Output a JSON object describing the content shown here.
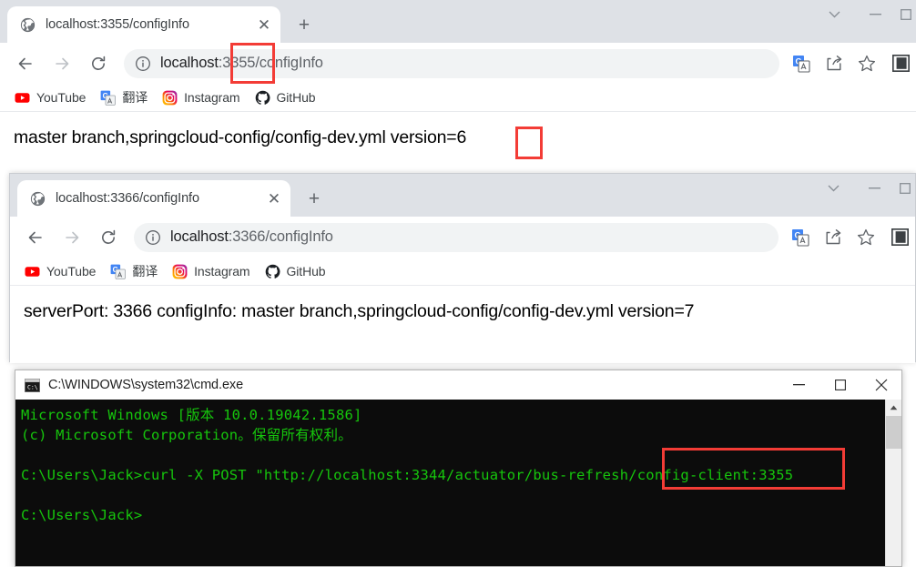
{
  "windows": {
    "browser1": {
      "tab": {
        "title": "localhost:3355/configInfo",
        "favicon": "globe-icon",
        "close_label": "✕",
        "newtab_label": "+"
      },
      "window_controls": {
        "tab_search": "chevron-down-icon",
        "minimize": "—",
        "maximize": "maximize-icon"
      },
      "toolbar": {
        "back": "back-arrow-icon",
        "forward": "forward-arrow-icon",
        "reload": "reload-icon",
        "info": "info-circle-icon",
        "url_prefix": "localhost",
        "url_port": ":3355",
        "url_path": "/configInfo",
        "url_full": "localhost:3355/configInfo",
        "translate": "translate-icon",
        "share": "share-icon",
        "bookmark": "star-icon",
        "side_panel": "side-panel-icon"
      },
      "bookmarks": [
        {
          "label": "YouTube",
          "icon": "youtube-icon"
        },
        {
          "label": "翻译",
          "icon": "google-translate-icon"
        },
        {
          "label": "Instagram",
          "icon": "instagram-icon"
        },
        {
          "label": "GitHub",
          "icon": "github-icon"
        }
      ],
      "content": {
        "text": "master branch,springcloud-config/config-dev.yml version=6",
        "highlighted_value": "6"
      }
    },
    "browser2": {
      "tab": {
        "title": "localhost:3366/configInfo",
        "favicon": "globe-icon",
        "close_label": "✕",
        "newtab_label": "+"
      },
      "window_controls": {
        "tab_search": "chevron-down-icon",
        "minimize": "—",
        "maximize": "maximize-icon"
      },
      "toolbar": {
        "back": "back-arrow-icon",
        "forward": "forward-arrow-icon",
        "reload": "reload-icon",
        "info": "info-circle-icon",
        "url_prefix": "localhost",
        "url_port": ":3366",
        "url_path": "/configInfo",
        "url_full": "localhost:3366/configInfo",
        "translate": "translate-icon",
        "share": "share-icon",
        "bookmark": "star-icon",
        "side_panel": "side-panel-icon"
      },
      "bookmarks": [
        {
          "label": "YouTube",
          "icon": "youtube-icon"
        },
        {
          "label": "翻译",
          "icon": "google-translate-icon"
        },
        {
          "label": "Instagram",
          "icon": "instagram-icon"
        },
        {
          "label": "GitHub",
          "icon": "github-icon"
        }
      ],
      "content": {
        "text": "serverPort: 3366 configInfo: master branch,springcloud-config/config-dev.yml version=7"
      }
    },
    "terminal": {
      "title": "C:\\WINDOWS\\system32\\cmd.exe",
      "icon": "cmd-icon",
      "window_controls": {
        "minimize": "─",
        "maximize": "☐",
        "close": "✕"
      },
      "lines": [
        "Microsoft Windows [版本 10.0.19042.1586]",
        "(c) Microsoft Corporation。保留所有权利。",
        "",
        "C:\\Users\\Jack>curl -X POST \"http://localhost:3344/actuator/bus-refresh/config-client:3355",
        "",
        "C:\\Users\\Jack>"
      ],
      "highlighted_fragment": "config-client:3355",
      "scrollbar": {
        "up_arrow": "▲"
      }
    }
  },
  "annotations": {
    "color": "#f33c36",
    "boxes": [
      {
        "name": "port-3355-highlight",
        "target": "3355"
      },
      {
        "name": "version-6-highlight",
        "target": "6"
      },
      {
        "name": "config-client-3355-highlight",
        "target": "config-client:3355"
      }
    ]
  }
}
